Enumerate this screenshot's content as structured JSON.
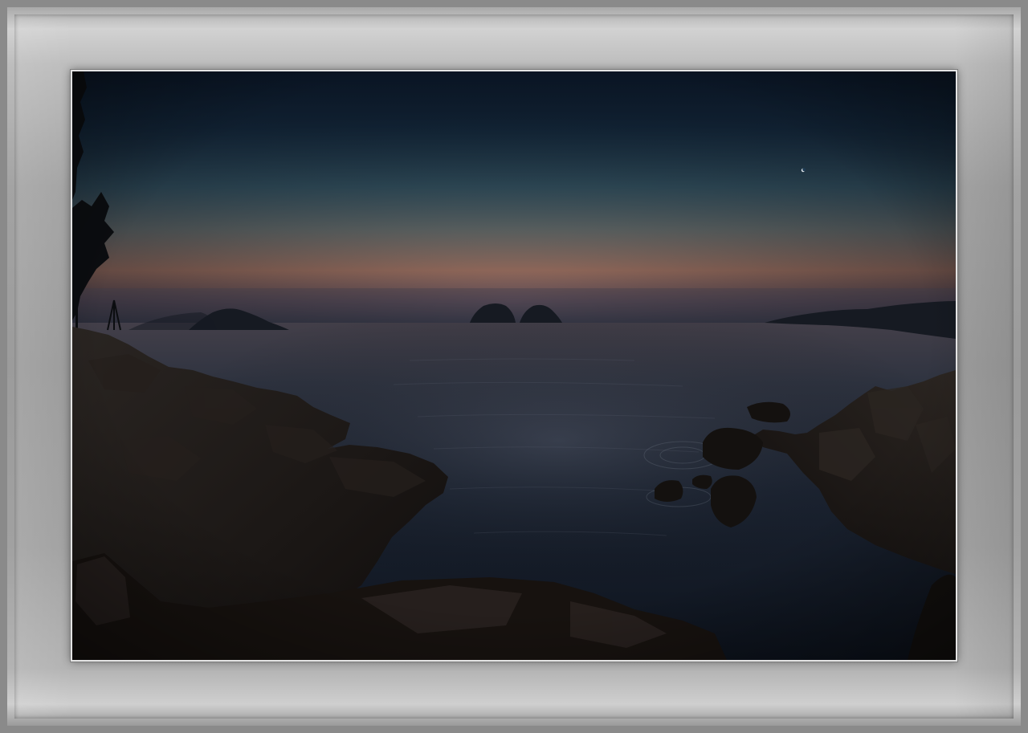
{
  "scene": {
    "subject": "sea-at-dusk-with-rocky-shore",
    "colors": {
      "frame": "#9e9e9e",
      "border": "#e4e4e4",
      "sky_top": "#0f2236",
      "sky_mid": "#3e6070",
      "horizon_glow": "#9c7060",
      "sea": "#1a2230",
      "rock": "#14110f"
    }
  }
}
